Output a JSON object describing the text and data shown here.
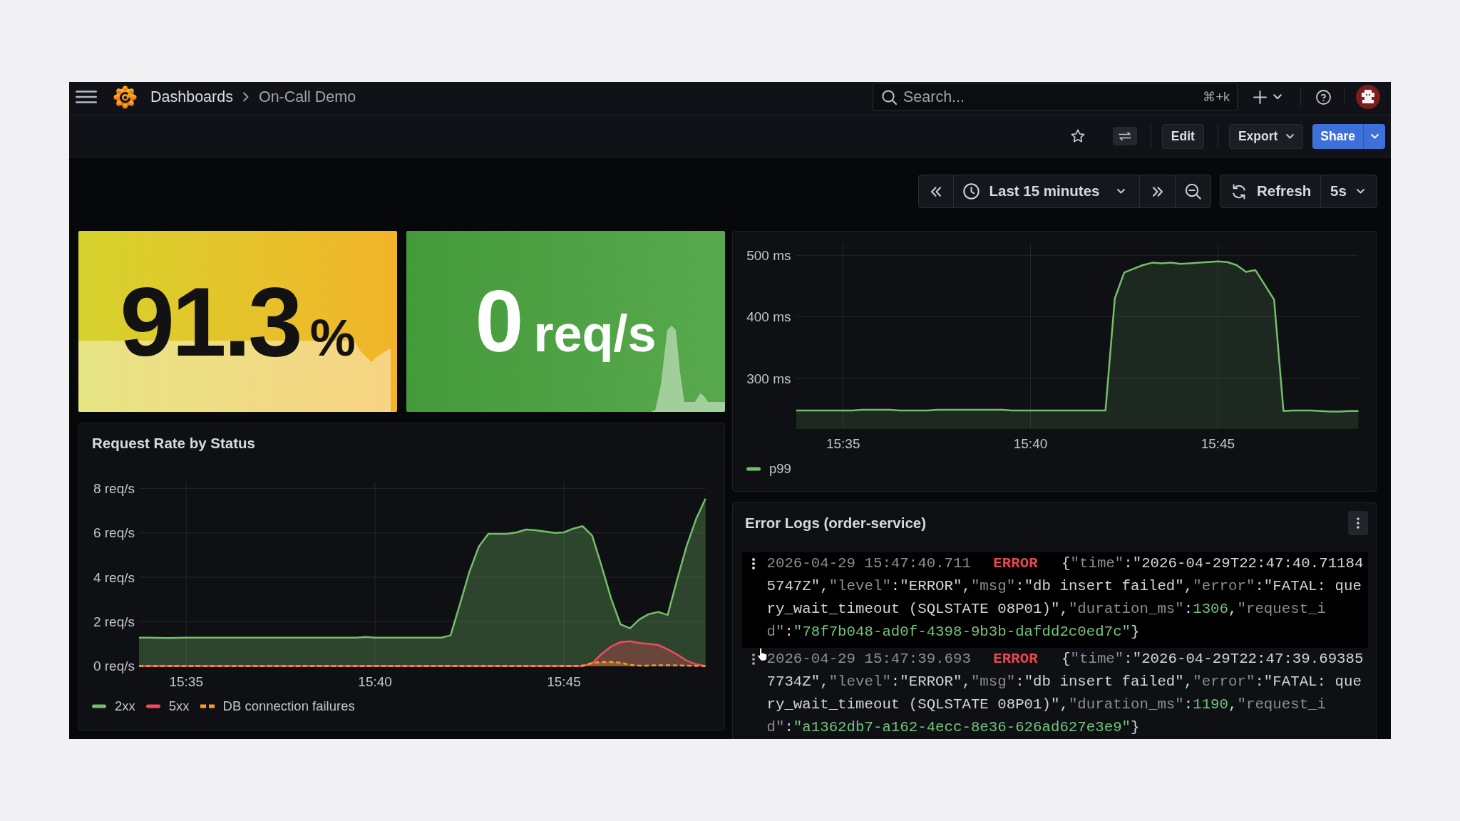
{
  "top_bar": {
    "breadcrumbs": [
      {
        "label": "Dashboards",
        "current": false
      },
      {
        "label": "On-Call Demo",
        "current": true
      }
    ],
    "search": {
      "placeholder": "Search...",
      "shortcut": "⌘+k"
    }
  },
  "toolbar": {
    "buttons": [
      {
        "label": "Edit",
        "kind": "plain"
      },
      {
        "label": "Export",
        "kind": "dropdown"
      },
      {
        "label": "Share",
        "kind": "split"
      }
    ]
  },
  "time_controls": {
    "range": "Last 15 minutes",
    "refresh": "Refresh",
    "interval": "5s"
  },
  "stat_panels": [
    {
      "value": "91.3",
      "unit": "%",
      "kind": "warning"
    },
    {
      "value": "0",
      "unit": "req/s",
      "kind": "ok"
    }
  ],
  "latency_panel": {
    "chart_data": {
      "type": "area",
      "grid": true,
      "categories": [
        null,
        null,
        null,
        null,
        null,
        "15:35",
        null,
        null,
        null,
        null,
        null,
        null,
        null,
        null,
        null,
        null,
        null,
        null,
        null,
        null,
        null,
        null,
        null,
        null,
        null,
        "15:40",
        null,
        null,
        null,
        null,
        null,
        null,
        null,
        null,
        null,
        null,
        null,
        null,
        null,
        null,
        null,
        null,
        null,
        null,
        null,
        "15:45",
        null,
        null,
        null,
        null,
        null,
        null,
        null,
        null,
        null,
        null,
        null,
        null,
        null,
        null,
        null
      ],
      "series": [
        {
          "name": "p99",
          "color": "#73bf69",
          "values": [
            248,
            248,
            248,
            248,
            248,
            248,
            248,
            249,
            249,
            249,
            249,
            248,
            248,
            248,
            248,
            249,
            249,
            249,
            249,
            249,
            249,
            249,
            249,
            248,
            248,
            248,
            248,
            248,
            248,
            248,
            248,
            248,
            248,
            248,
            430,
            472,
            478,
            484,
            488,
            487,
            488,
            486,
            487,
            488,
            489,
            490,
            489,
            484,
            473,
            476,
            452,
            428,
            247,
            248,
            248,
            248,
            247,
            246,
            246,
            247,
            247
          ]
        }
      ],
      "ylim": [
        218,
        519
      ],
      "yticks": [
        {
          "value": 300,
          "label": "300 ms"
        },
        {
          "value": 400,
          "label": "400 ms"
        },
        {
          "value": 500,
          "label": "500 ms"
        }
      ]
    }
  },
  "request_rate_panel": {
    "title": "Request Rate by Status",
    "chart_data": {
      "type": "area",
      "stacked": false,
      "grid": true,
      "categories": [
        null,
        null,
        null,
        null,
        null,
        "15:35",
        null,
        null,
        null,
        null,
        null,
        null,
        null,
        null,
        null,
        null,
        null,
        null,
        null,
        null,
        null,
        null,
        null,
        null,
        null,
        "15:40",
        null,
        null,
        null,
        null,
        null,
        null,
        null,
        null,
        null,
        null,
        null,
        null,
        null,
        null,
        null,
        null,
        null,
        null,
        null,
        "15:45",
        null,
        null,
        null,
        null,
        null,
        null,
        null,
        null,
        null,
        null,
        null,
        null,
        null,
        null,
        null
      ],
      "series": [
        {
          "name": "2xx",
          "color": "#73bf69",
          "values": [
            1.28,
            1.28,
            1.27,
            1.26,
            1.27,
            1.28,
            1.28,
            1.28,
            1.28,
            1.28,
            1.28,
            1.28,
            1.28,
            1.28,
            1.28,
            1.28,
            1.28,
            1.28,
            1.28,
            1.28,
            1.28,
            1.28,
            1.28,
            1.28,
            1.31,
            1.28,
            1.28,
            1.28,
            1.28,
            1.28,
            1.28,
            1.28,
            1.28,
            1.38,
            2.8,
            4.25,
            5.39,
            5.96,
            5.96,
            5.96,
            6.02,
            6.15,
            6.12,
            6.06,
            6.0,
            6.02,
            6.19,
            6.3,
            5.87,
            4.5,
            3.05,
            1.88,
            1.7,
            2.1,
            2.34,
            2.44,
            2.3,
            3.9,
            5.4,
            6.62,
            7.54
          ]
        },
        {
          "name": "5xx",
          "color": "#f2495c",
          "values": [
            0,
            0,
            0,
            0,
            0,
            0,
            0,
            0,
            0,
            0,
            0,
            0,
            0,
            0,
            0,
            0,
            0,
            0,
            0,
            0,
            0,
            0,
            0,
            0,
            0,
            0,
            0,
            0,
            0,
            0,
            0,
            0,
            0,
            0,
            0,
            0,
            0,
            0,
            0,
            0,
            0,
            0,
            0,
            0,
            0,
            0,
            0,
            0,
            0.12,
            0.55,
            0.88,
            1.08,
            1.12,
            1.04,
            1.0,
            0.95,
            0.75,
            0.52,
            0.25,
            0.08,
            0
          ]
        },
        {
          "name": "DB connection failures",
          "color": "#ff9830",
          "values": [
            0,
            0,
            0,
            0,
            0,
            0,
            0,
            0,
            0,
            0,
            0,
            0,
            0,
            0,
            0,
            0,
            0,
            0,
            0,
            0,
            0,
            0,
            0,
            0,
            0,
            0,
            0,
            0,
            0,
            0,
            0,
            0,
            0,
            0,
            0,
            0,
            0,
            0,
            0,
            0,
            0,
            0,
            0,
            0,
            0,
            0,
            0,
            0.02,
            0.14,
            0.18,
            0.19,
            0.15,
            0.05,
            0.02,
            0.02,
            0.04,
            0.04,
            0.03,
            0.02,
            0.01,
            0
          ]
        }
      ],
      "ylim": [
        0,
        8.3
      ],
      "yticks": [
        {
          "value": 0,
          "label": "0 req/s"
        },
        {
          "value": 2,
          "label": "2 req/s"
        },
        {
          "value": 4,
          "label": "4 req/s"
        },
        {
          "value": 6,
          "label": "6 req/s"
        },
        {
          "value": 8,
          "label": "8 req/s"
        }
      ]
    },
    "series_styles": [
      {
        "dashed": false
      },
      {
        "dashed": false
      },
      {
        "dashed": true
      }
    ]
  },
  "error_logs_panel": {
    "title": "Error Logs (order-service)",
    "rows": [
      {
        "highlighted": true,
        "timestamp": "2026-04-29 15:47:40.711",
        "level": "ERROR",
        "tokens": [
          {
            "kind": "text",
            "text": "{"
          },
          {
            "kind": "key",
            "text": "\"time\""
          },
          {
            "kind": "text",
            "text": ":\"2026-04-29T22:47:40.711845747Z\","
          },
          {
            "kind": "key",
            "text": "\"level\""
          },
          {
            "kind": "text",
            "text": ":\"ERROR\","
          },
          {
            "kind": "key",
            "text": "\"msg\""
          },
          {
            "kind": "text",
            "text": ":\"db insert failed\","
          },
          {
            "kind": "key",
            "text": "\"error\""
          },
          {
            "kind": "text",
            "text": ":\"FATAL: query_wait_timeout (SQLSTATE 08P01)\","
          },
          {
            "kind": "key",
            "text": "\"duration_ms\""
          },
          {
            "kind": "text",
            "text": ":"
          },
          {
            "kind": "highlight",
            "text": "1306"
          },
          {
            "kind": "text",
            "text": ","
          },
          {
            "kind": "key",
            "text": "\"request_id\""
          },
          {
            "kind": "text",
            "text": ":"
          },
          {
            "kind": "highlight",
            "text": "\"78f7b048-ad0f-4398-9b3b-dafdd2c0ed7c\""
          },
          {
            "kind": "text",
            "text": "}"
          }
        ]
      },
      {
        "highlighted": false,
        "timestamp": "2026-04-29 15:47:39.693",
        "level": "ERROR",
        "tokens": [
          {
            "kind": "text",
            "text": "{"
          },
          {
            "kind": "key",
            "text": "\"time\""
          },
          {
            "kind": "text",
            "text": ":\"2026-04-29T22:47:39.693857734Z\","
          },
          {
            "kind": "key",
            "text": "\"level\""
          },
          {
            "kind": "text",
            "text": ":\"ERROR\","
          },
          {
            "kind": "key",
            "text": "\"msg\""
          },
          {
            "kind": "text",
            "text": ":\"db insert failed\","
          },
          {
            "kind": "key",
            "text": "\"error\""
          },
          {
            "kind": "text",
            "text": ":\"FATAL: query_wait_timeout (SQLSTATE 08P01)\","
          },
          {
            "kind": "key",
            "text": "\"duration_ms\""
          },
          {
            "kind": "text",
            "text": ":"
          },
          {
            "kind": "highlight",
            "text": "1190"
          },
          {
            "kind": "text",
            "text": ","
          },
          {
            "kind": "key",
            "text": "\"request_id\""
          },
          {
            "kind": "text",
            "text": ":"
          },
          {
            "kind": "highlight",
            "text": "\"a1362db7-a162-4ecc-8e36-626ad627e3e9\""
          },
          {
            "kind": "text",
            "text": "}"
          }
        ]
      }
    ]
  }
}
